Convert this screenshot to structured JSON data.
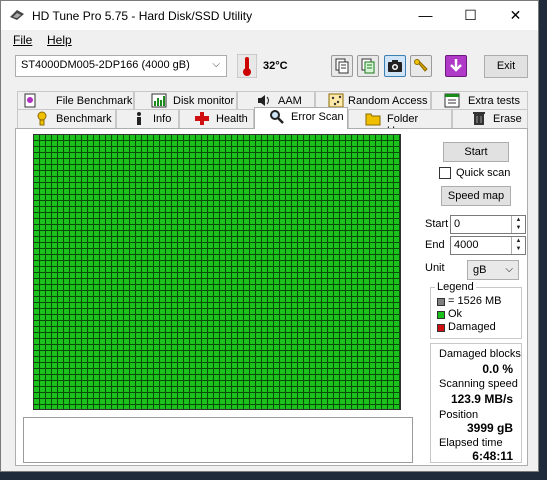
{
  "window": {
    "title": "HD Tune Pro 5.75 - Hard Disk/SSD Utility",
    "minimize": "—",
    "maximize": "☐",
    "close": "✕"
  },
  "menu": {
    "file": "File",
    "help": "Help"
  },
  "toolbar": {
    "drive": "ST4000DM005-2DP166 (4000 gB)",
    "temperature": "32°C",
    "exit_label": "Exit"
  },
  "tabs_top": [
    {
      "label": "File Benchmark",
      "icon": "file-benchmark-icon"
    },
    {
      "label": "Disk monitor",
      "icon": "disk-monitor-icon"
    },
    {
      "label": "AAM",
      "icon": "speaker-icon"
    },
    {
      "label": "Random Access",
      "icon": "random-access-icon"
    },
    {
      "label": "Extra tests",
      "icon": "extra-tests-icon"
    }
  ],
  "tabs_bottom": [
    {
      "label": "Benchmark",
      "icon": "benchmark-icon"
    },
    {
      "label": "Info",
      "icon": "info-icon"
    },
    {
      "label": "Health",
      "icon": "health-cross-icon"
    },
    {
      "label": "Error Scan",
      "icon": "magnifier-icon"
    },
    {
      "label": "Folder Usage",
      "icon": "folder-icon"
    },
    {
      "label": "Erase",
      "icon": "trash-icon"
    }
  ],
  "active_tab": "Error Scan",
  "scan": {
    "start_button": "Start",
    "quick_scan_label": "Quick scan",
    "quick_scan_checked": false,
    "speed_map_button": "Speed map",
    "start_label": "Start",
    "start_value": "0",
    "end_label": "End",
    "end_value": "4000",
    "unit_label": "Unit",
    "unit_value": "gB",
    "grid_color": "#1bc21b",
    "grid_status": "all ok"
  },
  "legend": {
    "title": "Legend",
    "items": [
      {
        "label": "= 1526 MB",
        "color": "#808080"
      },
      {
        "label": "Ok",
        "color": "#19c019"
      },
      {
        "label": "Damaged",
        "color": "#d01010"
      }
    ]
  },
  "stats": {
    "damaged_label": "Damaged blocks",
    "damaged_value": "0.0 %",
    "speed_label": "Scanning speed",
    "speed_value": "123.9 MB/s",
    "position_label": "Position",
    "position_value": "3999 gB",
    "elapsed_label": "Elapsed time",
    "elapsed_value": "6:48:11"
  }
}
